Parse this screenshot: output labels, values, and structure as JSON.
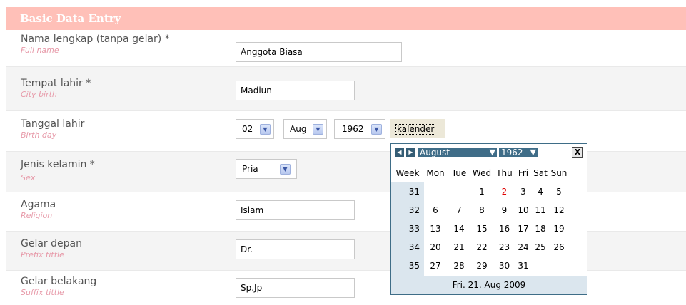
{
  "header": {
    "title": "Basic Data Entry"
  },
  "fields": {
    "nama": {
      "label": "Nama lengkap (tanpa gelar) *",
      "sub": "Full name",
      "value": "Anggota Biasa"
    },
    "tempat": {
      "label": "Tempat lahir *",
      "sub": "City birth",
      "value": "Madiun"
    },
    "tanggal": {
      "label": "Tanggal lahir",
      "sub": "Birth day",
      "day": "02",
      "month": "Aug",
      "year": "1962",
      "kalender_label": "kalender"
    },
    "jenis": {
      "label": "Jenis kelamin *",
      "sub": "Sex",
      "value": "Pria"
    },
    "agama": {
      "label": "Agama",
      "sub": "Religion",
      "value": "Islam"
    },
    "gelar_depan": {
      "label": "Gelar depan",
      "sub": "Prefix tittle",
      "value": "Dr."
    },
    "gelar_belakang": {
      "label": "Gelar belakang",
      "sub": "Suffix tittle",
      "value": "Sp.Jp"
    }
  },
  "calendar": {
    "month": "August",
    "year": "1962",
    "close": "X",
    "headers": [
      "Week",
      "Mon",
      "Tue",
      "Wed",
      "Thu",
      "Fri",
      "Sat",
      "Sun"
    ],
    "weeks": [
      {
        "week": "31",
        "days": [
          "",
          "",
          "1",
          "2",
          "3",
          "4",
          "5"
        ]
      },
      {
        "week": "32",
        "days": [
          "6",
          "7",
          "8",
          "9",
          "10",
          "11",
          "12"
        ]
      },
      {
        "week": "33",
        "days": [
          "13",
          "14",
          "15",
          "16",
          "17",
          "18",
          "19"
        ]
      },
      {
        "week": "34",
        "days": [
          "20",
          "21",
          "22",
          "23",
          "24",
          "25",
          "26"
        ]
      },
      {
        "week": "35",
        "days": [
          "27",
          "28",
          "29",
          "30",
          "31",
          "",
          ""
        ]
      }
    ],
    "footer": "Fri. 21. Aug 2009",
    "highlight_color": "#e00000"
  },
  "colors": {
    "header_bg": "#ffc0b8",
    "sub_label": "#e79aa9",
    "calendar_accent": "#3f6d88"
  }
}
